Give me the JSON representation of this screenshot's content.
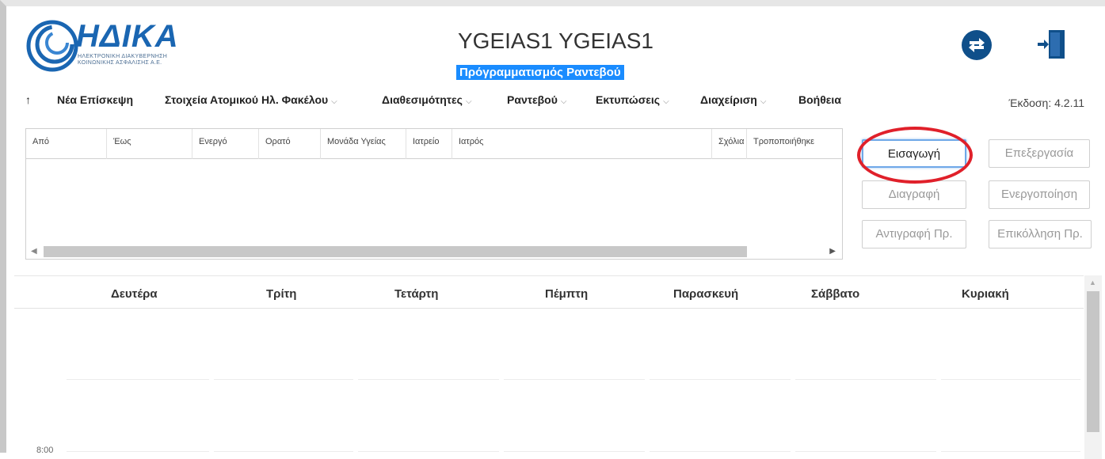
{
  "header": {
    "logo_text": "ΗΔΙΚΑ",
    "logo_subtitle_1": "ΗΛΕΚΤΡΟΝΙΚΗ ΔΙΑΚΥΒΕΡΝΗΣΗ",
    "logo_subtitle_2": "ΚΟΙΝΩΝΙΚΗΣ ΑΣΦΑΛΙΣΗΣ Α.Ε.",
    "title": "YGEIAS1 YGEIAS1",
    "subtitle": "Πρόγραμματισμός Ραντεβού",
    "icons": [
      "switch-arrows-icon",
      "logout-door-icon"
    ]
  },
  "nav": {
    "up_arrow": "↑",
    "items": [
      {
        "label": "Νέα Επίσκεψη",
        "has_dropdown": false
      },
      {
        "label": "Στοιχεία Ατομικού Ηλ. Φακέλου",
        "has_dropdown": true
      },
      {
        "label": "Διαθεσιμότητες",
        "has_dropdown": true
      },
      {
        "label": "Ραντεβού",
        "has_dropdown": true
      },
      {
        "label": "Εκτυπώσεις",
        "has_dropdown": true
      },
      {
        "label": "Διαχείριση",
        "has_dropdown": true
      },
      {
        "label": "Βοήθεια",
        "has_dropdown": false
      }
    ],
    "chevron": "⌵",
    "version": "Έκδοση: 4.2.11"
  },
  "grid": {
    "columns": [
      "Από",
      "Έως",
      "Ενεργό",
      "Ορατό",
      "Μονάδα Υγείας",
      "Ιατρείο",
      "Ιατρός",
      "Σχόλια",
      "Τροποποιήθηκε"
    ],
    "rows": [],
    "arrow_left": "◀",
    "arrow_right": "▶"
  },
  "actions": {
    "insert": "Εισαγωγή",
    "edit": "Επεξεργασία",
    "delete": "Διαγραφή",
    "activate": "Ενεργοποίηση",
    "copy": "Αντιγραφή Πρ.",
    "paste": "Επικόλληση Πρ."
  },
  "calendar": {
    "days": [
      "Δευτέρα",
      "Τρίτη",
      "Τετάρτη",
      "Πέμπτη",
      "Παρασκευή",
      "Σάββατο",
      "Κυριακή"
    ],
    "first_time": "8:00",
    "scroll_up": "▲"
  },
  "colors": {
    "brand": "#1a66b2",
    "subtitle_bg": "#1a8cff",
    "highlight": "#e0202a"
  }
}
